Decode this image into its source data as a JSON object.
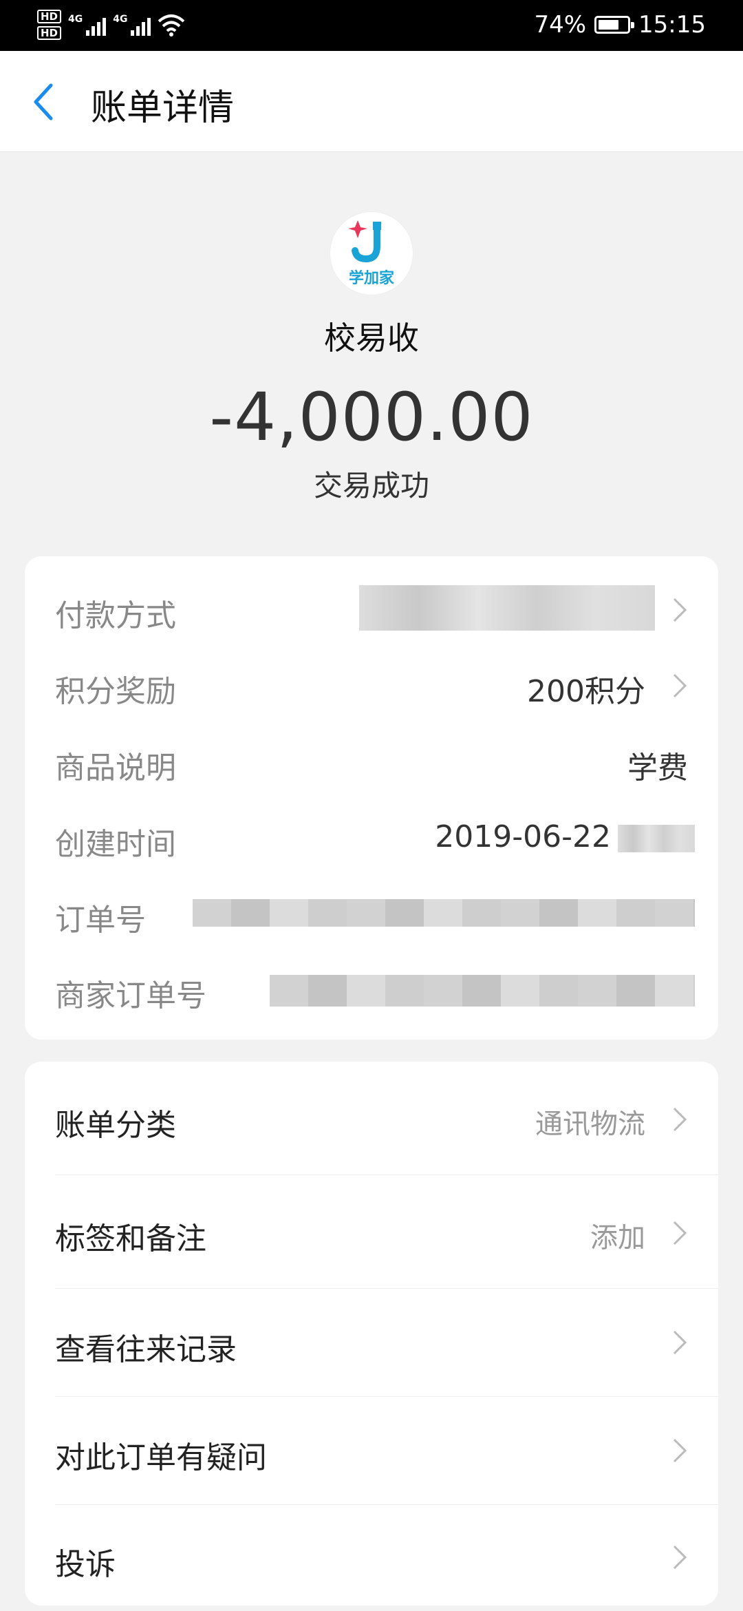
{
  "status_bar": {
    "network_a": "4G",
    "network_b": "4G",
    "hd_a": "HD",
    "hd_b": "HD",
    "battery_percent": "74%",
    "battery_level": 0.74,
    "time": "15:15"
  },
  "nav": {
    "title": "账单详情"
  },
  "summary": {
    "logo_text": "学加家",
    "merchant": "校易收",
    "amount": "-4,000.00",
    "status": "交易成功"
  },
  "details": {
    "payment_method_label": "付款方式",
    "points_label": "积分奖励",
    "points_value": "200积分",
    "product_label": "商品说明",
    "product_value": "学费",
    "created_label": "创建时间",
    "created_value": "2019-06-22",
    "order_label": "订单号",
    "merchant_order_label": "商家订单号"
  },
  "actions": {
    "category_label": "账单分类",
    "category_value": "通讯物流",
    "tags_label": "标签和备注",
    "tags_value": "添加",
    "history_label": "查看往来记录",
    "question_label": "对此订单有疑问",
    "complaint_label": "投诉"
  },
  "colors": {
    "accent": "#1a8cf0",
    "logo_blue": "#1aa3d6",
    "logo_red": "#e8375a"
  }
}
